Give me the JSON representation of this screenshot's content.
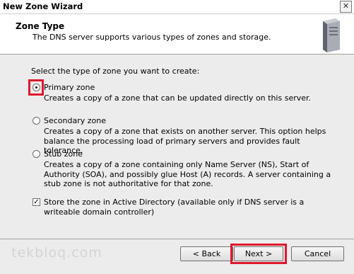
{
  "window": {
    "title": "New Zone Wizard",
    "close_symbol": "✕"
  },
  "header": {
    "title": "Zone Type",
    "subtitle": "The DNS server supports various types of zones and storage."
  },
  "prompt": "Select the type of zone you want to create:",
  "options": [
    {
      "label": "Primary zone",
      "description": "Creates a copy of a zone that can be updated directly on this server.",
      "selected": true
    },
    {
      "label": "Secondary zone",
      "description": "Creates a copy of a zone that exists on another server. This option helps balance the processing load of primary servers and provides fault tolerance.",
      "selected": false
    },
    {
      "label": "Stub zone",
      "description": "Creates a copy of a zone containing only Name Server (NS), Start of Authority (SOA), and possibly glue Host (A) records. A server containing a stub zone is not authoritative for that zone.",
      "selected": false
    }
  ],
  "store_ad": {
    "checked": true,
    "check_symbol": "✓",
    "label": "Store the zone in Active Directory (available only if DNS server is a writeable domain controller)"
  },
  "buttons": {
    "back": "< Back",
    "next": "Next >",
    "cancel": "Cancel"
  },
  "watermark": "tekbloq.com",
  "colors": {
    "highlight": "#e0182c",
    "dialog_bg": "#ececec"
  }
}
